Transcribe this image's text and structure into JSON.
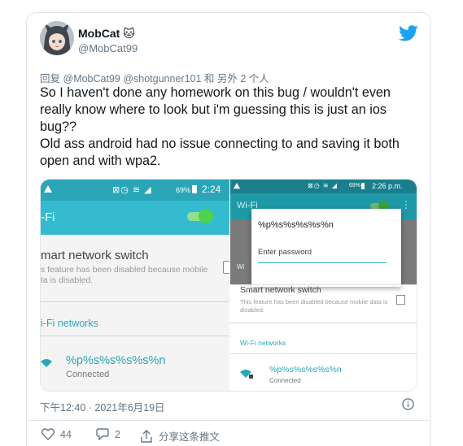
{
  "author": {
    "name": "MobCat",
    "emoji": "🐱",
    "handle": "@MobCat99"
  },
  "reply": {
    "prefix": "回复",
    "mentions": "@MobCat99 @shotgunner101",
    "suffix": "和 另外 2 个人"
  },
  "tweet": {
    "line1": "So I haven't done any homework on this bug / wouldn't even really know where to look but i'm guessing this is just an ios bug??",
    "line2": "Old ass android had no issue connecting to and saving it both open and with wpa2."
  },
  "left_screen": {
    "time": "2:24",
    "battery": "69%",
    "title": "-Fi",
    "switch_title": "mart network switch",
    "switch_desc": "s feature has been disabled because mobile ta is disabled.",
    "networks_label": "i-Fi networks",
    "network_name": "%p%s%s%s%s%n",
    "network_status": "Connected"
  },
  "right_screen": {
    "time": "2:26 p.m.",
    "battery": "69%",
    "title": "Wi-Fi",
    "dialog_ssid": "%p%s%s%s%s%n",
    "dialog_placeholder": "Enter password",
    "switch_title": "Smart network switch",
    "switch_desc": "This feature has been disabled because mobile data is disabled.",
    "networks_label": "Wi-Fi networks",
    "network_name": "%p%s%s%s%s%n",
    "network_status": "Connected",
    "partial_label": "Wi"
  },
  "meta": {
    "timestamp": "下午12:40 · 2021年6月19日"
  },
  "actions": {
    "likes": "44",
    "replies": "2",
    "share": "分享这条推文"
  },
  "colors": {
    "teal": "#35bbd0",
    "twitter_blue": "#1da1f2",
    "text": "#14171a",
    "muted": "#657786"
  }
}
